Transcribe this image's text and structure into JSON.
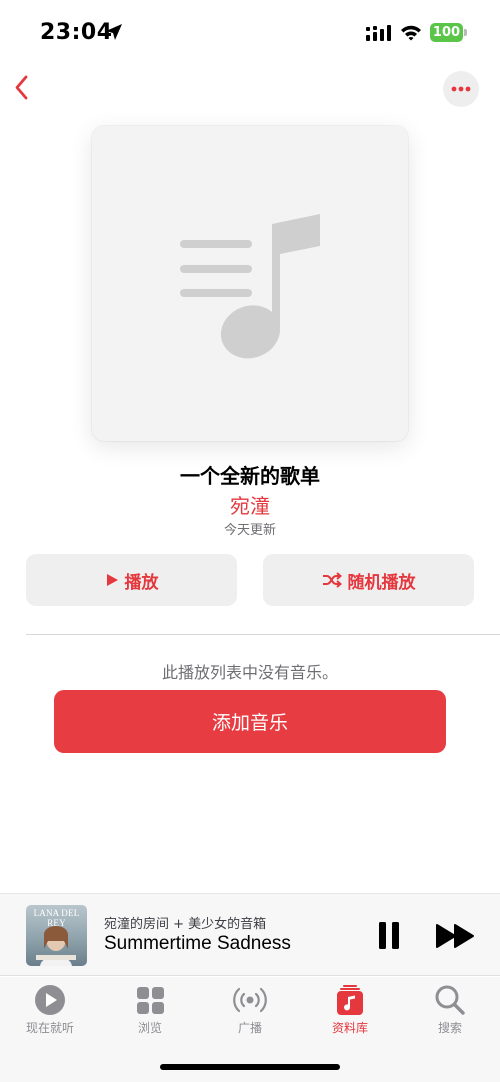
{
  "status_bar": {
    "time": "23:04",
    "battery": "100"
  },
  "colors": {
    "accent": "#e5383e",
    "add_button": "#e83c43",
    "battery": "#5ac549"
  },
  "icons": {
    "back": "chevron-left-icon",
    "more": "ellipsis-icon",
    "artwork": "music-note-icon",
    "play": "play-icon",
    "shuffle": "shuffle-icon",
    "pause": "pause-icon",
    "forward": "fast-forward-icon"
  },
  "playlist": {
    "title": "一个全新的歌单",
    "owner": "宛潼",
    "updated": "今天更新",
    "play_label": "播放",
    "shuffle_label": "随机播放",
    "empty_message": "此播放列表中没有音乐。",
    "add_music_label": "添加音乐"
  },
  "now_playing": {
    "album_text": "LANA DEL REY",
    "source": "宛潼的房间 + 美少女的音箱",
    "song": "Summertime Sadness"
  },
  "tabs": [
    {
      "label": "现在就听",
      "icon": "play-circle-icon",
      "active": false
    },
    {
      "label": "浏览",
      "icon": "grid-icon",
      "active": false
    },
    {
      "label": "广播",
      "icon": "radio-icon",
      "active": false
    },
    {
      "label": "资料库",
      "icon": "library-icon",
      "active": true
    },
    {
      "label": "搜索",
      "icon": "search-icon",
      "active": false
    }
  ]
}
